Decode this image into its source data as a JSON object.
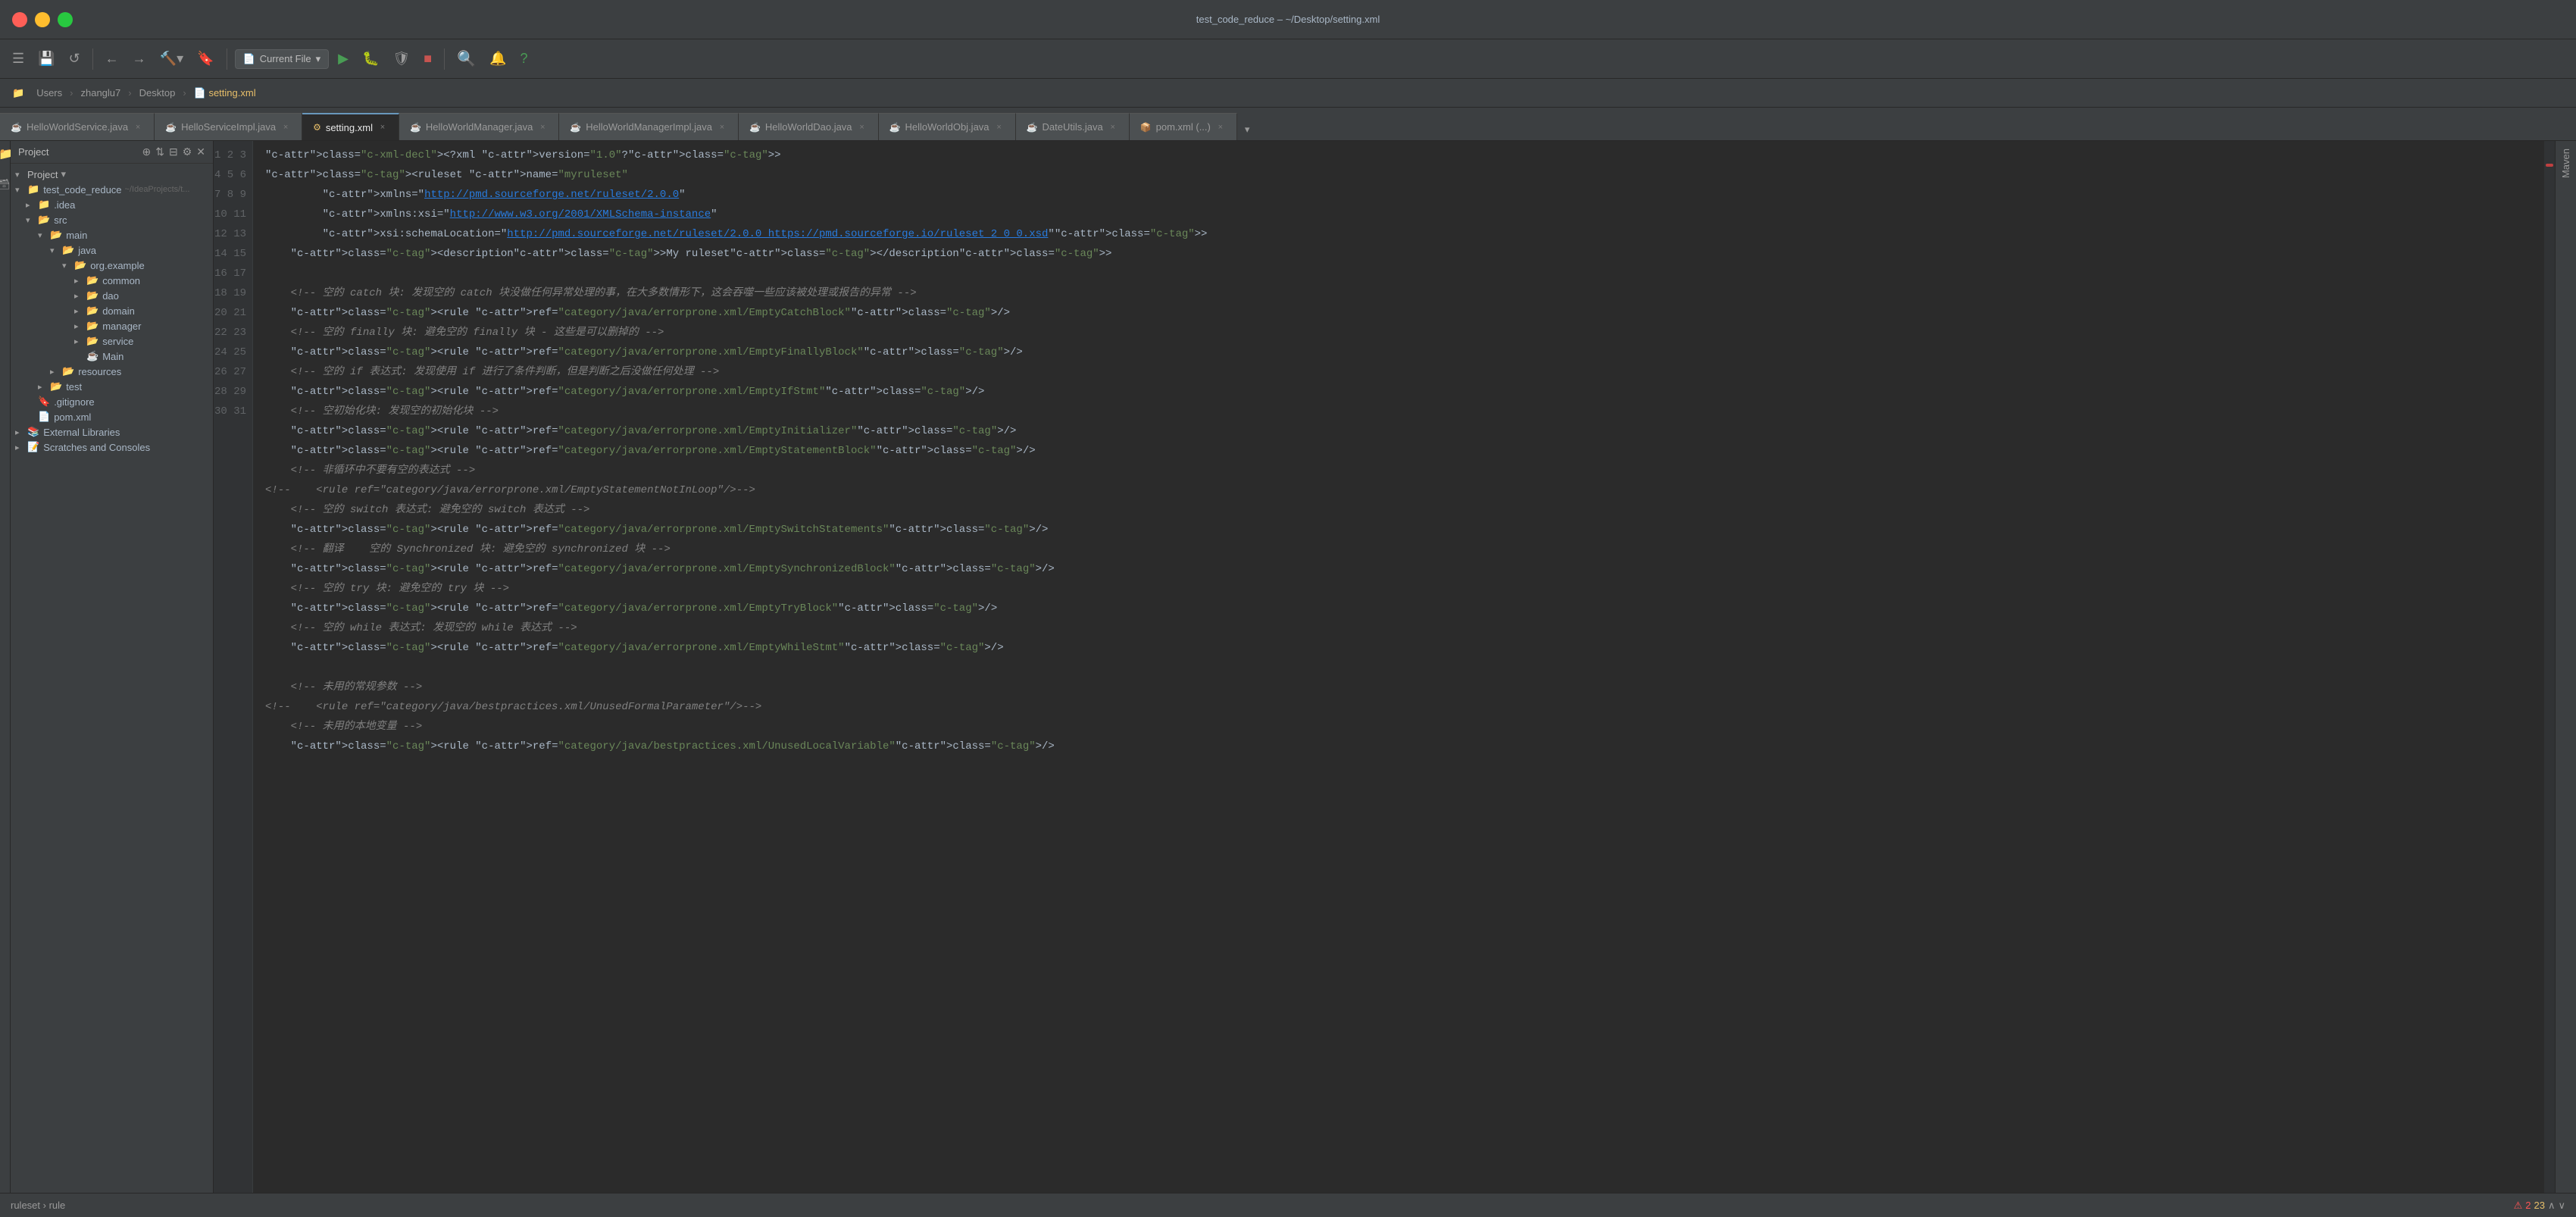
{
  "window": {
    "title": "test_code_reduce – ~/Desktop/setting.xml"
  },
  "titlebar": {
    "title": "test_code_reduce – ~/Desktop/setting.xml"
  },
  "toolbar": {
    "project_dropdown": "Project",
    "run_config": "Current File",
    "buttons": [
      "navigate_back",
      "navigate_forward",
      "build",
      "run",
      "debug",
      "stop",
      "find",
      "profile",
      "coverage"
    ]
  },
  "breadcrumb": {
    "items": [
      "Users",
      "zhanglu7",
      "Desktop",
      "setting.xml"
    ]
  },
  "file_tabs": [
    {
      "name": "HelloWorldService.java",
      "type": "java",
      "active": false
    },
    {
      "name": "HelloServiceImpl.java",
      "type": "java",
      "active": false
    },
    {
      "name": "setting.xml",
      "type": "xml",
      "active": true
    },
    {
      "name": "HelloWorldManager.java",
      "type": "java",
      "active": false
    },
    {
      "name": "HelloWorldManagerImpl.java",
      "type": "java",
      "active": false
    },
    {
      "name": "HelloWorldDao.java",
      "type": "java",
      "active": false
    },
    {
      "name": "HelloWorldObj.java",
      "type": "java",
      "active": false
    },
    {
      "name": "DateUtils.java",
      "type": "java",
      "active": false
    },
    {
      "name": "pom.xml (...)",
      "type": "pom",
      "active": false
    }
  ],
  "project_panel": {
    "header": "Project",
    "tree": [
      {
        "level": 0,
        "label": "Project",
        "icon": "dropdown",
        "expanded": true
      },
      {
        "level": 0,
        "label": "test_code_reduce",
        "icon": "folder",
        "expanded": true,
        "path": "~/IdeaProjects/t..."
      },
      {
        "level": 1,
        "label": ".idea",
        "icon": "folder",
        "expanded": false
      },
      {
        "level": 1,
        "label": "src",
        "icon": "folder-src",
        "expanded": true
      },
      {
        "level": 2,
        "label": "main",
        "icon": "folder",
        "expanded": true
      },
      {
        "level": 3,
        "label": "java",
        "icon": "folder",
        "expanded": true
      },
      {
        "level": 4,
        "label": "org.example",
        "icon": "folder",
        "expanded": true
      },
      {
        "level": 5,
        "label": "common",
        "icon": "folder",
        "expanded": false
      },
      {
        "level": 5,
        "label": "dao",
        "icon": "folder",
        "expanded": false
      },
      {
        "level": 5,
        "label": "domain",
        "icon": "folder",
        "expanded": false
      },
      {
        "level": 5,
        "label": "manager",
        "icon": "folder",
        "expanded": false
      },
      {
        "level": 5,
        "label": "service",
        "icon": "folder",
        "expanded": false
      },
      {
        "level": 5,
        "label": "Main",
        "icon": "java",
        "expanded": false
      },
      {
        "level": 3,
        "label": "resources",
        "icon": "folder-res",
        "expanded": false
      },
      {
        "level": 2,
        "label": "test",
        "icon": "folder-test",
        "expanded": false
      },
      {
        "level": 1,
        "label": ".gitignore",
        "icon": "git",
        "expanded": false
      },
      {
        "level": 1,
        "label": "pom.xml",
        "icon": "xml",
        "expanded": false
      },
      {
        "level": 0,
        "label": "External Libraries",
        "icon": "folder",
        "expanded": false
      },
      {
        "level": 0,
        "label": "Scratches and Consoles",
        "icon": "folder",
        "expanded": false
      }
    ]
  },
  "editor": {
    "lines": [
      {
        "n": 1,
        "code": "<?xml version=\"1.0\"?>"
      },
      {
        "n": 2,
        "code": "<ruleset name=\"myruleset\""
      },
      {
        "n": 3,
        "code": "         xmlns=\"http://pmd.sourceforge.net/ruleset/2.0.0\""
      },
      {
        "n": 4,
        "code": "         xmlns:xsi=\"http://www.w3.org/2001/XMLSchema-instance\""
      },
      {
        "n": 5,
        "code": "         xsi:schemaLocation=\"http://pmd.sourceforge.net/ruleset/2.0.0 https://pmd.sourceforge.io/ruleset_2_0_0.xsd\">"
      },
      {
        "n": 6,
        "code": "    <description>My ruleset</description>"
      },
      {
        "n": 7,
        "code": ""
      },
      {
        "n": 8,
        "code": "    <!-- 空的 catch 块: 发现空的 catch 块没做任何异常处理的事，在大多数情形下，这会吞噬一些应该被处理或报告的异常 -->"
      },
      {
        "n": 9,
        "code": "    <rule ref=\"category/java/errorprone.xml/EmptyCatchBlock\"/>"
      },
      {
        "n": 10,
        "code": "    <!-- 空的 finally 块: 避免空的 finally 块 - 这些是可以删掉的 -->"
      },
      {
        "n": 11,
        "code": "    <rule ref=\"category/java/errorprone.xml/EmptyFinallyBlock\"/>"
      },
      {
        "n": 12,
        "code": "    <!-- 空的 if 表达式: 发现使用 if 进行了条件判断，但是判断之后没做任何处理 -->"
      },
      {
        "n": 13,
        "code": "    <rule ref=\"category/java/errorprone.xml/EmptyIfStmt\"/>"
      },
      {
        "n": 14,
        "code": "    <!-- 空初始化块: 发现空的初始化块 -->"
      },
      {
        "n": 15,
        "code": "    <rule ref=\"category/java/errorprone.xml/EmptyInitializer\"/>"
      },
      {
        "n": 16,
        "code": "    <rule ref=\"category/java/errorprone.xml/EmptyStatementBlock\"/>"
      },
      {
        "n": 17,
        "code": "    <!-- 非循环中不要有空的表达式 -->"
      },
      {
        "n": 18,
        "code": "<!--    <rule ref=\"category/java/errorprone.xml/EmptyStatementNotInLoop\"/>-->"
      },
      {
        "n": 19,
        "code": "    <!-- 空的 switch 表达式: 避免空的 switch 表达式 -->"
      },
      {
        "n": 20,
        "code": "    <rule ref=\"category/java/errorprone.xml/EmptySwitchStatements\"/>"
      },
      {
        "n": 21,
        "code": "    <!-- 翻译    空的 Synchronized 块: 避免空的 synchronized 块 -->"
      },
      {
        "n": 22,
        "code": "    <rule ref=\"category/java/errorprone.xml/EmptySynchronizedBlock\"/>"
      },
      {
        "n": 23,
        "code": "    <!-- 空的 try 块: 避免空的 try 块 -->"
      },
      {
        "n": 24,
        "code": "    <rule ref=\"category/java/errorprone.xml/EmptyTryBlock\"/>"
      },
      {
        "n": 25,
        "code": "    <!-- 空的 while 表达式: 发现空的 while 表达式 -->"
      },
      {
        "n": 26,
        "code": "    <rule ref=\"category/java/errorprone.xml/EmptyWhileStmt\"/>"
      },
      {
        "n": 27,
        "code": ""
      },
      {
        "n": 28,
        "code": "    <!-- 未用的常规参数 -->"
      },
      {
        "n": 29,
        "code": "<!--    <rule ref=\"category/java/bestpractices.xml/UnusedFormalParameter\"/>-->"
      },
      {
        "n": 30,
        "code": "    <!-- 未用的本地变量 -->"
      },
      {
        "n": 31,
        "code": "    <rule ref=\"category/java/bestpractices.xml/UnusedLocalVariable\"/>"
      }
    ]
  },
  "status_bar": {
    "errors": "2",
    "warnings": "23",
    "path": "ruleset › rule",
    "error_icon": "⚠",
    "up_icon": "∧",
    "down_icon": "∨"
  },
  "maven": {
    "label": "Maven"
  }
}
